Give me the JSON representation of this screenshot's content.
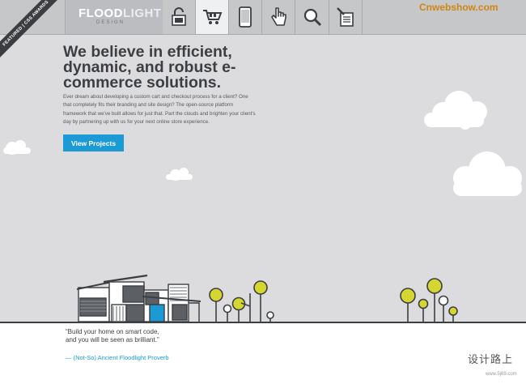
{
  "header": {
    "logo_text_a": "FLOOD",
    "logo_text_b": "LIGHT",
    "logo_sub": "DESIGN",
    "ribbon": "FEATURED | CSS AWARDS",
    "nav_icons": [
      "lock-icon",
      "cart-icon",
      "tablet-icon",
      "pointer-hand-icon",
      "search-icon",
      "edit-icon"
    ],
    "active_index": 1
  },
  "watermark_top": "Cnwebshow.com",
  "hero": {
    "headline": "We believe in efficient, dynamic, and robust e-commerce solutions.",
    "intro": "Ever dream about developing a custom cart and checkout process for a client? One that completely fits their branding and site design? The open-source platform framework that we've built allows for just that. Part the clouds and brighten your client's day by partnering up with us for your next online store experience.",
    "cta_label": "View Projects"
  },
  "footer": {
    "quote": "“Build your home on smart code,\nand you will be seen as brilliant.”",
    "proverb": "— (Not-So) Ancient Floodlight Proverb"
  },
  "watermark_bottom": {
    "cn": "设计路上",
    "url": "www.5j69.com"
  },
  "colors": {
    "background": "#dcdcde",
    "accent_blue": "#1b9ad6",
    "tree_yellow": "#d6d630",
    "ink": "#3b3e43",
    "brand_orange": "#d08612"
  }
}
